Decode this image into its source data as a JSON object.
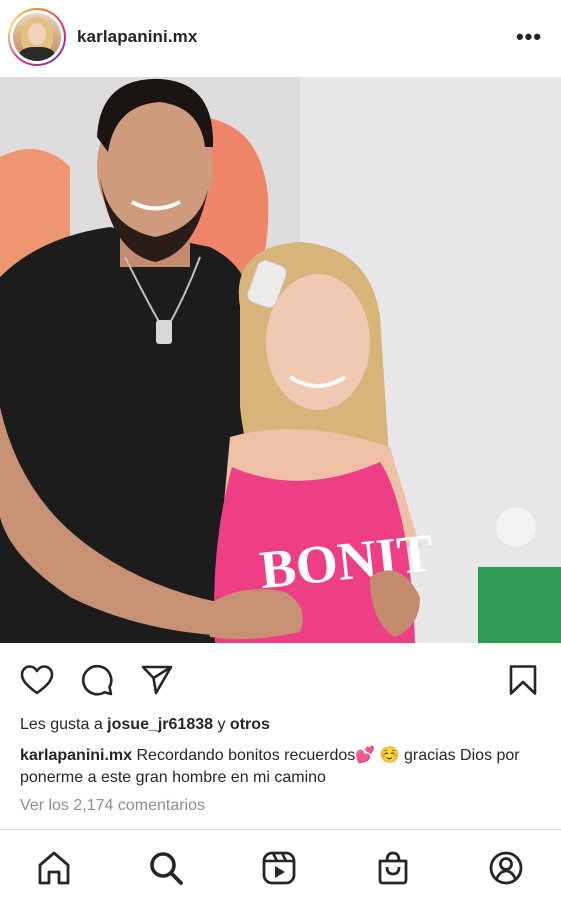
{
  "post": {
    "username": "karlapanini.mx",
    "more_label": "•••",
    "photo_text": "BONIT"
  },
  "likes": {
    "prefix": "Les gusta a ",
    "user": "josue_jr61838",
    "middle": " y ",
    "others": "otros"
  },
  "caption": {
    "username": "karlapanini.mx",
    "text": " Recordando bonitos recuerdos💕 ☺️ gracias Dios por ponerme a este gran hombre en mi camino"
  },
  "comments_link": "Ver los 2,174 comentarios",
  "icons": {
    "like": "heart-icon",
    "comment": "comment-icon",
    "share": "send-icon",
    "save": "bookmark-icon",
    "home": "home-icon",
    "search": "search-icon",
    "reels": "reels-icon",
    "shop": "shop-icon",
    "profile": "profile-icon"
  },
  "colors": {
    "text": "#262626",
    "muted": "#8e8e8e",
    "divider": "#dbdbdb",
    "shirt_pink": "#ee3f86"
  }
}
